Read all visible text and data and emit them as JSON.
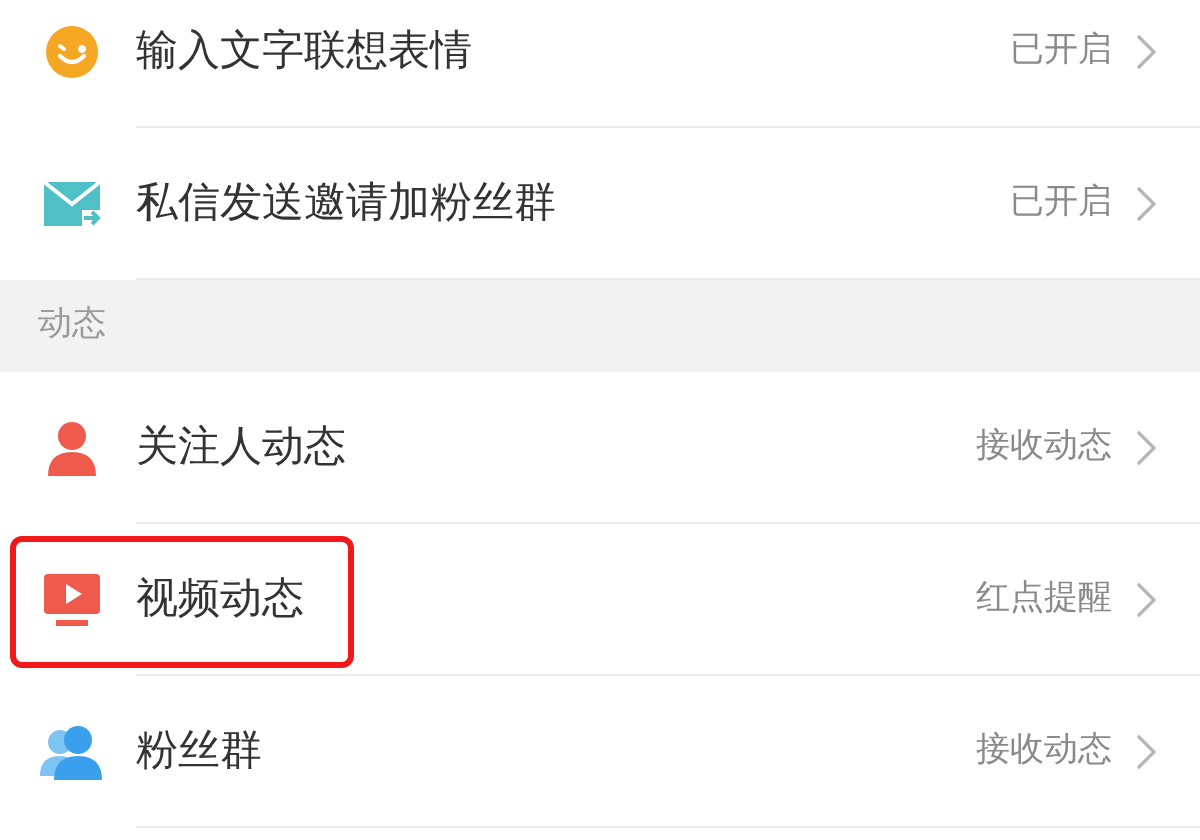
{
  "sections": [
    {
      "items": [
        {
          "label": "输入文字联想表情",
          "value": "已开启",
          "highlighted": false
        },
        {
          "label": "私信发送邀请加粉丝群",
          "value": "已开启",
          "highlighted": false
        }
      ]
    },
    {
      "header": "动态",
      "items": [
        {
          "label": "关注人动态",
          "value": "接收动态",
          "highlighted": false
        },
        {
          "label": "视频动态",
          "value": "红点提醒",
          "highlighted": true
        },
        {
          "label": "粉丝群",
          "value": "接收动态",
          "highlighted": false
        }
      ]
    }
  ]
}
